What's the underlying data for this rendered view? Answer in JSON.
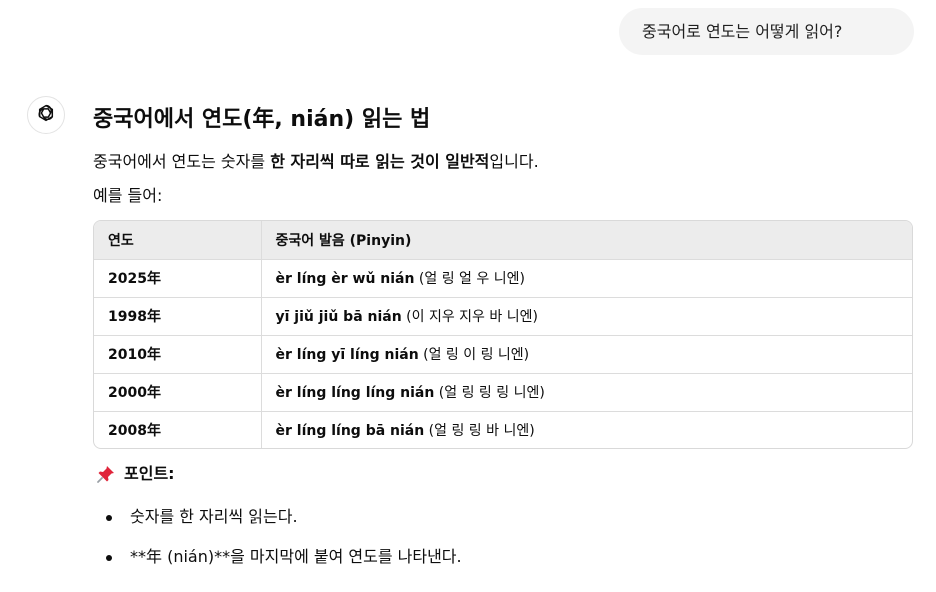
{
  "user_message": "중국어로 연도는 어떻게 읽어?",
  "answer": {
    "title": "중국어에서 연도(年, nián) 읽는 법",
    "intro_before": "중국어에서 연도는 숫자를 ",
    "intro_bold": "한 자리씩 따로 읽는 것이 일반적",
    "intro_after": "입니다.",
    "example_label": "예를 들어:",
    "table": {
      "headers": [
        "연도",
        "중국어 발음 (Pinyin)"
      ],
      "rows": [
        {
          "year": "2025年",
          "pinyin": "èr líng èr wǔ nián",
          "reading": " (얼 링 얼 우 니엔)"
        },
        {
          "year": "1998年",
          "pinyin": "yī jiǔ jiǔ bā nián",
          "reading": " (이 지우 지우 바 니엔)"
        },
        {
          "year": "2010年",
          "pinyin": "èr líng yī líng nián",
          "reading": " (얼 링 이 링 니엔)"
        },
        {
          "year": "2000年",
          "pinyin": "èr líng líng líng nián",
          "reading": " (얼 링 링 링 니엔)"
        },
        {
          "year": "2008年",
          "pinyin": "èr líng líng bā nián",
          "reading": " (얼 링 링 바 니엔)"
        }
      ]
    },
    "point_title": "포인트:",
    "bullets": [
      "숫자를 한 자리씩 읽는다.",
      "**年 (nián)**을 마지막에 붙여 연도를 나타낸다."
    ]
  },
  "icons": {
    "assistant": "openai-logo-icon",
    "pin": "pushpin-icon"
  },
  "colors": {
    "bubble_bg": "#f4f4f4",
    "table_header_bg": "#ececec",
    "pin_red": "#e0243a"
  }
}
